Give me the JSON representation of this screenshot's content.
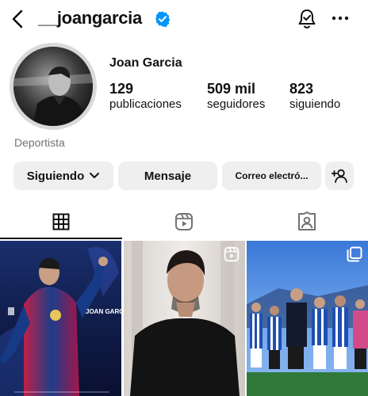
{
  "header": {
    "username": "__joangarcia",
    "icons": {
      "back": "chevron-left-icon",
      "verified": "verified-badge-icon",
      "notifications": "bell-check-icon",
      "more": "more-horizontal-icon"
    },
    "accent_color": "#0095f6"
  },
  "profile": {
    "name": "Joan Garcia",
    "category": "Deportista",
    "stats": [
      {
        "value": "129",
        "label": "publicaciones"
      },
      {
        "value": "509 mil",
        "label": "seguidores"
      },
      {
        "value": "823",
        "label": "siguiendo"
      }
    ]
  },
  "actions": {
    "following_label": "Siguiendo",
    "message_label": "Mensaje",
    "email_label": "Correo electró...",
    "add_user_icon": "add-user-icon"
  },
  "tabs": [
    {
      "icon": "grid-icon",
      "active": true
    },
    {
      "icon": "reels-icon",
      "active": false
    },
    {
      "icon": "tagged-icon",
      "active": false
    }
  ],
  "posts": [
    {
      "caption": "JOAN GARCIA",
      "badge": ""
    },
    {
      "caption": "",
      "badge": "reel-icon"
    },
    {
      "caption": "",
      "badge": "carousel-icon"
    }
  ]
}
